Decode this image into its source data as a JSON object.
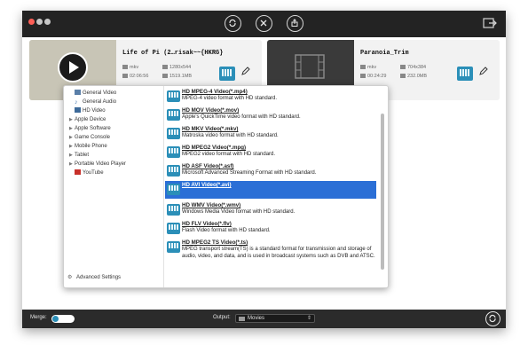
{
  "toolbar": {
    "buttons": [
      "convert-icon",
      "tools-icon",
      "share-icon"
    ],
    "right_icon": "export-icon"
  },
  "files": [
    {
      "title": "Life of Pi (2…risak~~{HKRG}",
      "format": "mkv",
      "resolution": "1280x544",
      "duration": "02:06:56",
      "size": "1519.1MB"
    },
    {
      "title": "Paranoia_Trim",
      "format": "mkv",
      "resolution": "704x384",
      "duration": "00:24:29",
      "size": "232.0MB"
    }
  ],
  "categories": [
    {
      "label": "General Video",
      "arrow": "",
      "icon": "film-icon"
    },
    {
      "label": "General Audio",
      "arrow": "",
      "icon": "music-icon"
    },
    {
      "label": "HD Video",
      "arrow": "",
      "icon": "hd-icon"
    },
    {
      "label": "Apple Device",
      "arrow": "▶",
      "icon": ""
    },
    {
      "label": "Apple Software",
      "arrow": "▶",
      "icon": ""
    },
    {
      "label": "Game Console",
      "arrow": "▶",
      "icon": ""
    },
    {
      "label": "Mobile Phone",
      "arrow": "▶",
      "icon": ""
    },
    {
      "label": "Tablet",
      "arrow": "▶",
      "icon": ""
    },
    {
      "label": "Portable Video Player",
      "arrow": "▶",
      "icon": ""
    },
    {
      "label": "YouTube",
      "arrow": "",
      "icon": "youtube-icon"
    }
  ],
  "advanced_settings": "Advanced Settings",
  "formats": [
    {
      "name": "HD MPEG-4 Video(*.mp4)",
      "desc": "MPEG-4 video format with HD standard."
    },
    {
      "name": "HD MOV Video(*.mov)",
      "desc": "Apple's QuickTime video format with HD standard."
    },
    {
      "name": "HD MKV Video(*.mkv)",
      "desc": "Matroska video format with HD standard."
    },
    {
      "name": "HD MPEG2 Video(*.mpg)",
      "desc": "MPEG2 video format with HD standard."
    },
    {
      "name": "HD ASF Video(*.asf)",
      "desc": "Microsoft Advanced Streaming Format with HD standard."
    },
    {
      "name": "HD AVI Video(*.avi)",
      "desc": "",
      "selected": true
    },
    {
      "name": "HD WMV Video(*.wmv)",
      "desc": "Windows Media Video format with HD standard."
    },
    {
      "name": "HD FLV Video(*.flv)",
      "desc": "Flash Video format with HD standard."
    },
    {
      "name": "HD MPEG2 TS Video(*.ts)",
      "desc": "MPEG transport stream(TS) is a standard format for transmission and storage of audio, video, and data, and is used in broadcast systems such as DVB and ATSC."
    }
  ],
  "bottom": {
    "merge_label": "Merge:",
    "output_label": "Output:",
    "output_value": "Movies"
  },
  "colors": {
    "accent": "#2b6fd6",
    "titlebar": "#232323",
    "bottombar": "#2b2b2b"
  }
}
